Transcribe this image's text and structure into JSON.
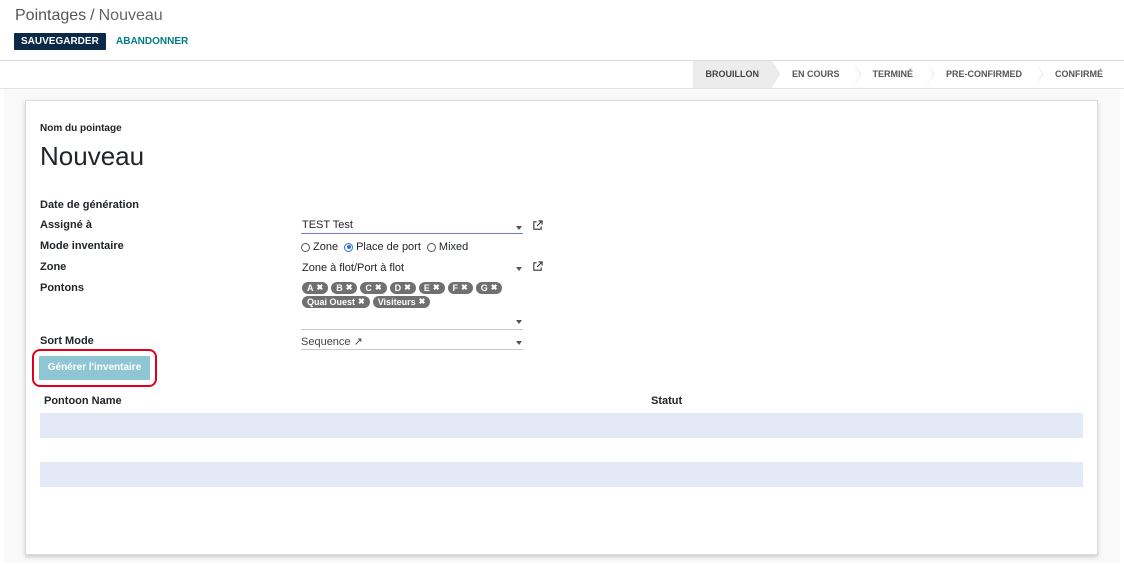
{
  "breadcrumb": {
    "parent": "Pointages",
    "separator": "/",
    "current": "Nouveau"
  },
  "toolbar": {
    "save_label": "SAUVEGARDER",
    "discard_label": "ABANDONNER"
  },
  "statusbar": {
    "stages": [
      "BROUILLON",
      "EN COURS",
      "TERMINÉ",
      "PRE-CONFIRMED",
      "CONFIRMÉ"
    ],
    "active": "BROUILLON"
  },
  "form": {
    "name_label": "Nom du pointage",
    "name_value": "Nouveau",
    "date_label": "Date de génération",
    "assigned_label": "Assigné à",
    "assigned_value": "TEST Test",
    "mode_label": "Mode inventaire",
    "mode_options": [
      "Zone",
      "Place de port",
      "Mixed"
    ],
    "mode_selected": "Place de port",
    "zone_label": "Zone",
    "zone_value": "Zone à flot/Port à flot",
    "pontons_label": "Pontons",
    "pontons_tags": [
      "A",
      "B",
      "C",
      "D",
      "E",
      "F",
      "G",
      "Quai Ouest",
      "Visiteurs"
    ],
    "sort_label": "Sort Mode",
    "sort_value": "Sequence ↗",
    "generate_button": "Générer l'inventaire"
  },
  "table": {
    "columns": [
      "Pontoon Name",
      "Statut"
    ]
  },
  "colors": {
    "primary": "#0b2a4a",
    "accent": "#017e84",
    "highlight": "#e0001b"
  }
}
